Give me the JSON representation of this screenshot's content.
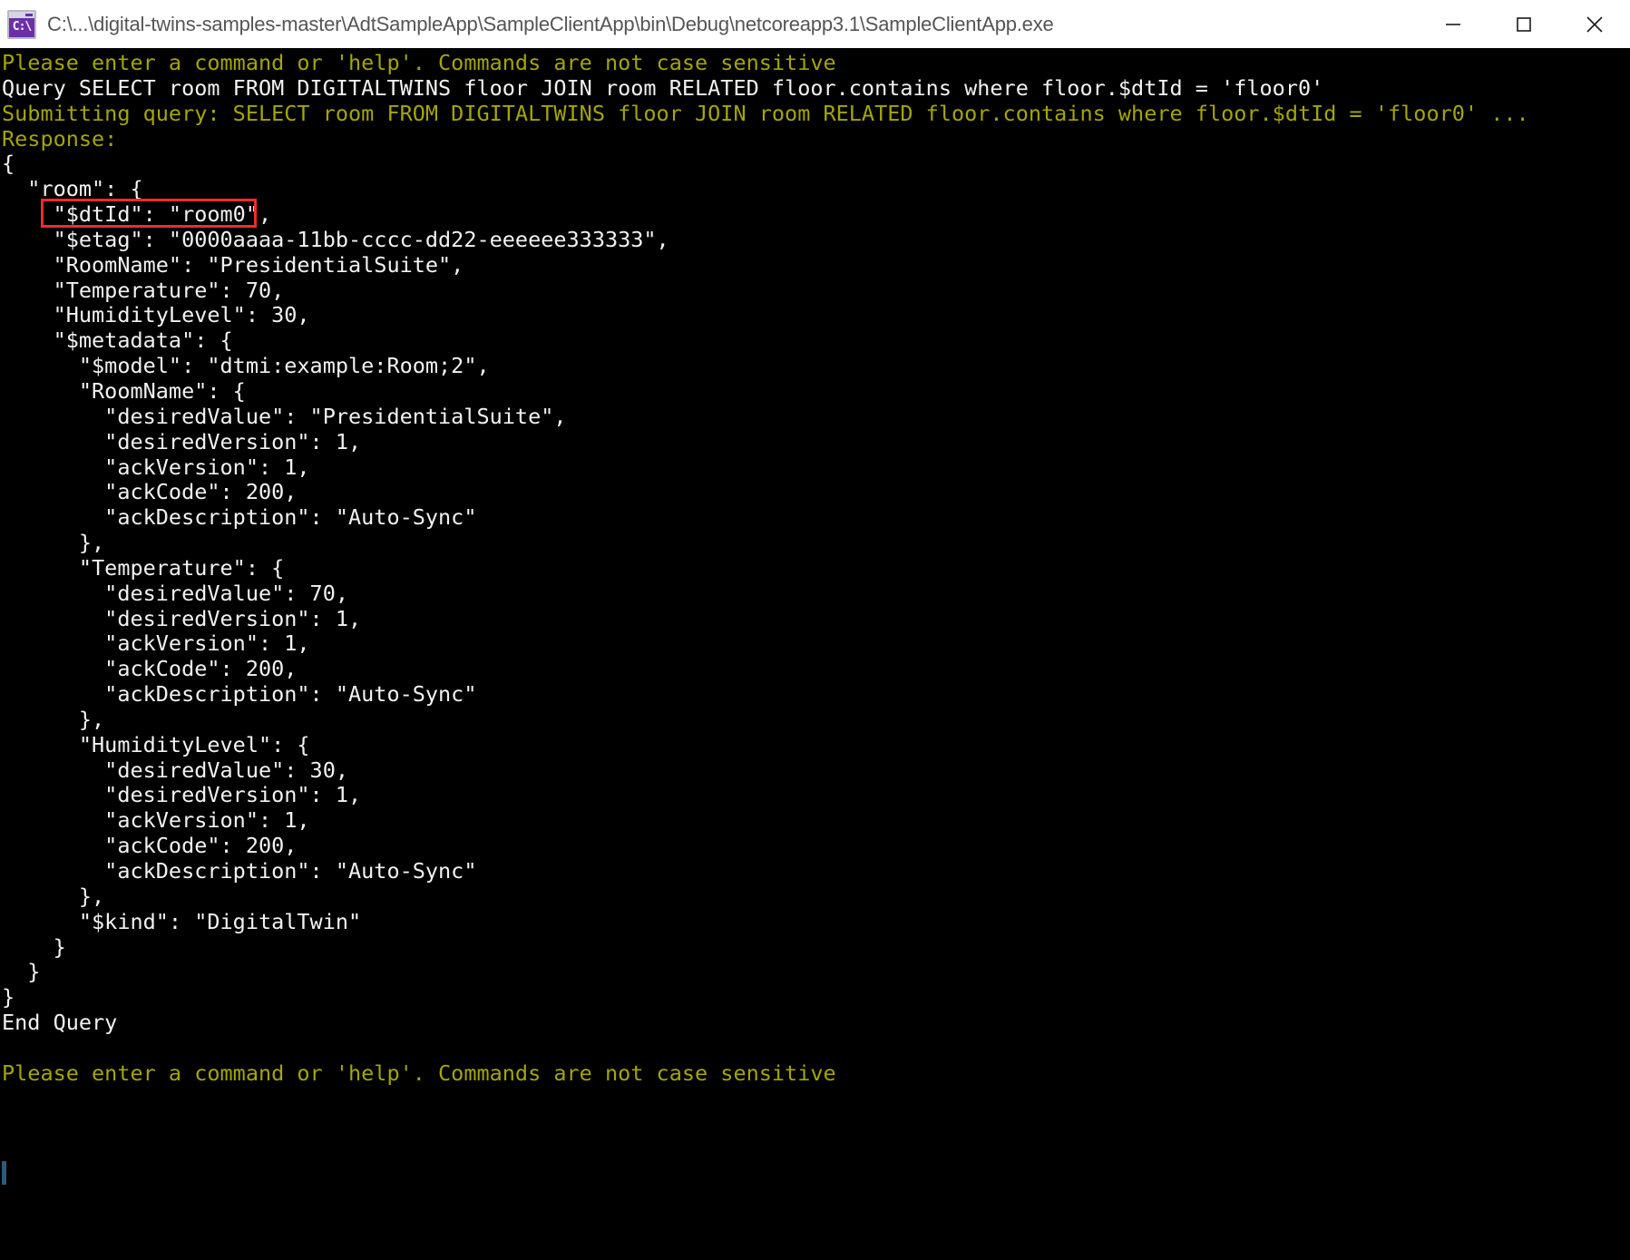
{
  "window": {
    "title": "C:\\...\\digital-twins-samples-master\\AdtSampleApp\\SampleClientApp\\bin\\Debug\\netcoreapp3.1\\SampleClientApp.exe",
    "icon": "console-cmd-icon",
    "icon_glyph": "C:\\",
    "controls": {
      "minimize": "minimize-button",
      "maximize": "maximize-button",
      "close": "close-button"
    },
    "titlebar_bg": "#ffffff",
    "titlebar_fg": "#555555",
    "console_bg": "#000000"
  },
  "colors": {
    "prompt_yellow": "#a5a500",
    "output_white": "#f2f2f2",
    "highlight_red": "#ef2b2b",
    "cursor": "#2d5a7a"
  },
  "console": {
    "lines": [
      {
        "text": "Please enter a command or 'help'. Commands are not case sensitive",
        "color": "yellow"
      },
      {
        "text": "Query SELECT room FROM DIGITALTWINS floor JOIN room RELATED floor.contains where floor.$dtId = 'floor0'",
        "color": "white"
      },
      {
        "text": "Submitting query: SELECT room FROM DIGITALTWINS floor JOIN room RELATED floor.contains where floor.$dtId = 'floor0' ...",
        "color": "yellow"
      },
      {
        "text": "Response:",
        "color": "yellow"
      },
      {
        "text": "{",
        "color": "white"
      },
      {
        "text": "  \"room\": {",
        "color": "white"
      },
      {
        "text": "    \"$dtId\": \"room0\",",
        "color": "white"
      },
      {
        "text": "    \"$etag\": \"0000aaaa-11bb-cccc-dd22-eeeeee333333\",",
        "color": "white"
      },
      {
        "text": "    \"RoomName\": \"PresidentialSuite\",",
        "color": "white"
      },
      {
        "text": "    \"Temperature\": 70,",
        "color": "white"
      },
      {
        "text": "    \"HumidityLevel\": 30,",
        "color": "white"
      },
      {
        "text": "    \"$metadata\": {",
        "color": "white"
      },
      {
        "text": "      \"$model\": \"dtmi:example:Room;2\",",
        "color": "white"
      },
      {
        "text": "      \"RoomName\": {",
        "color": "white"
      },
      {
        "text": "        \"desiredValue\": \"PresidentialSuite\",",
        "color": "white"
      },
      {
        "text": "        \"desiredVersion\": 1,",
        "color": "white"
      },
      {
        "text": "        \"ackVersion\": 1,",
        "color": "white"
      },
      {
        "text": "        \"ackCode\": 200,",
        "color": "white"
      },
      {
        "text": "        \"ackDescription\": \"Auto-Sync\"",
        "color": "white"
      },
      {
        "text": "      },",
        "color": "white"
      },
      {
        "text": "      \"Temperature\": {",
        "color": "white"
      },
      {
        "text": "        \"desiredValue\": 70,",
        "color": "white"
      },
      {
        "text": "        \"desiredVersion\": 1,",
        "color": "white"
      },
      {
        "text": "        \"ackVersion\": 1,",
        "color": "white"
      },
      {
        "text": "        \"ackCode\": 200,",
        "color": "white"
      },
      {
        "text": "        \"ackDescription\": \"Auto-Sync\"",
        "color": "white"
      },
      {
        "text": "      },",
        "color": "white"
      },
      {
        "text": "      \"HumidityLevel\": {",
        "color": "white"
      },
      {
        "text": "        \"desiredValue\": 30,",
        "color": "white"
      },
      {
        "text": "        \"desiredVersion\": 1,",
        "color": "white"
      },
      {
        "text": "        \"ackVersion\": 1,",
        "color": "white"
      },
      {
        "text": "        \"ackCode\": 200,",
        "color": "white"
      },
      {
        "text": "        \"ackDescription\": \"Auto-Sync\"",
        "color": "white"
      },
      {
        "text": "      },",
        "color": "white"
      },
      {
        "text": "      \"$kind\": \"DigitalTwin\"",
        "color": "white"
      },
      {
        "text": "    }",
        "color": "white"
      },
      {
        "text": "  }",
        "color": "white"
      },
      {
        "text": "}",
        "color": "white"
      },
      {
        "text": "End Query",
        "color": "white"
      },
      {
        "text": "",
        "color": "white"
      },
      {
        "text": "Please enter a command or 'help'. Commands are not case sensitive",
        "color": "yellow"
      },
      {
        "text": "",
        "color": "white"
      }
    ]
  },
  "annotation": {
    "highlight_target": "\"$dtId\": \"room0\",",
    "highlight_color": "#ef2b2b"
  }
}
